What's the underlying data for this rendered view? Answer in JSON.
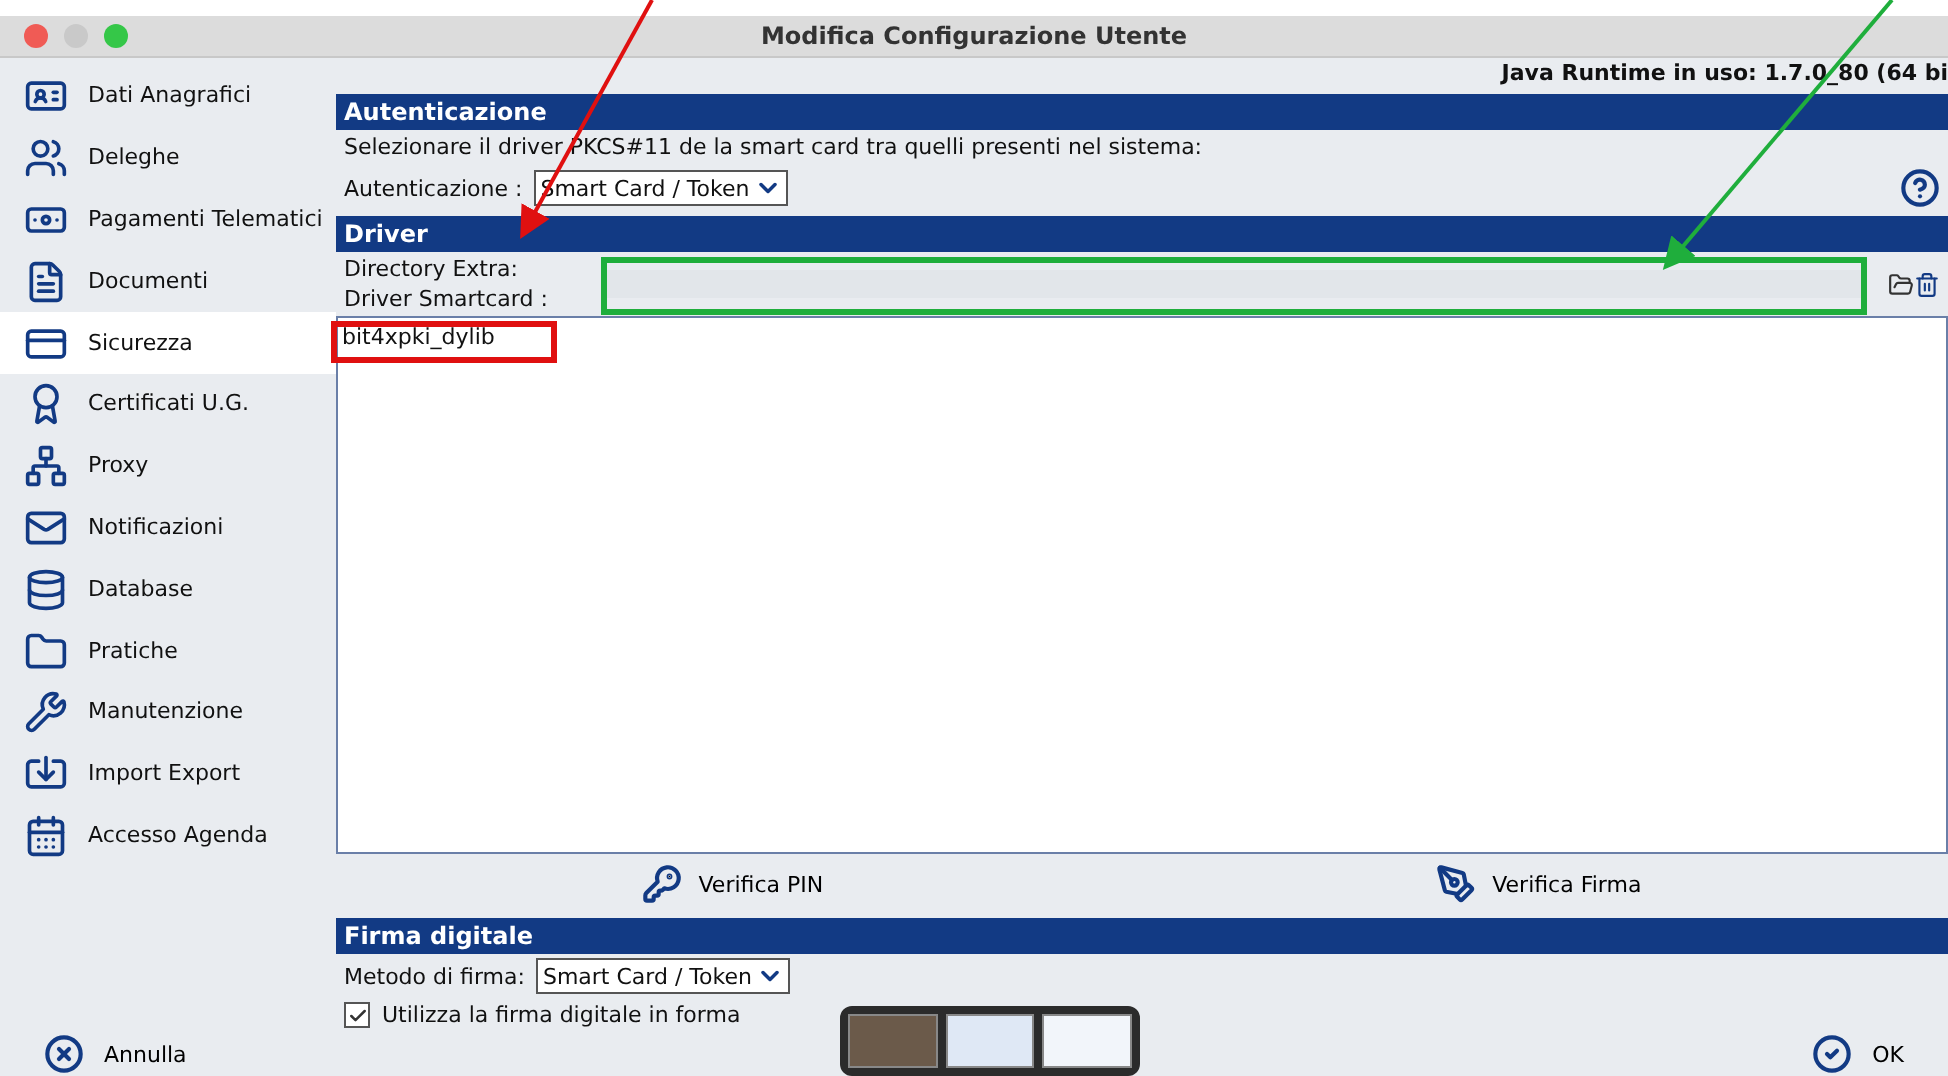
{
  "window": {
    "title": "Modifica Configurazione Utente"
  },
  "sidebar": {
    "items": [
      {
        "label": "Dati Anagrafici",
        "selected": false
      },
      {
        "label": "Deleghe",
        "selected": false
      },
      {
        "label": "Pagamenti Telematici",
        "selected": false
      },
      {
        "label": "Documenti",
        "selected": false
      },
      {
        "label": "Sicurezza",
        "selected": true
      },
      {
        "label": "Certificati U.G.",
        "selected": false
      },
      {
        "label": "Proxy",
        "selected": false
      },
      {
        "label": "Notificazioni",
        "selected": false
      },
      {
        "label": "Database",
        "selected": false
      },
      {
        "label": "Pratiche",
        "selected": false
      },
      {
        "label": "Manutenzione",
        "selected": false
      },
      {
        "label": "Import Export",
        "selected": false
      },
      {
        "label": "Accesso Agenda",
        "selected": false
      }
    ]
  },
  "runtime": "Java Runtime in uso: 1.7.0_80 (64 bi",
  "auth": {
    "header": "Autenticazione",
    "description": "Selezionare il driver PKCS#11 de la smart card tra quelli presenti nel sistema:",
    "label": "Autenticazione :",
    "value": "Smart Card / Token"
  },
  "driver": {
    "header": "Driver",
    "dir_label": "Directory Extra:",
    "smartcard_label": "Driver Smartcard :",
    "items": [
      {
        "label": "bit4xpki_dylib",
        "selected": false
      }
    ]
  },
  "actions": [
    "Verifica PIN",
    "Verifica Firma"
  ],
  "firma": {
    "header": "Firma digitale",
    "label": "Metodo di firma:",
    "value": "Smart Card / Token",
    "checkbox": {
      "label": "Utilizza la firma digitale in forma",
      "checked": true
    }
  },
  "footer": {
    "cancel": "Annulla",
    "ok": "OK"
  }
}
